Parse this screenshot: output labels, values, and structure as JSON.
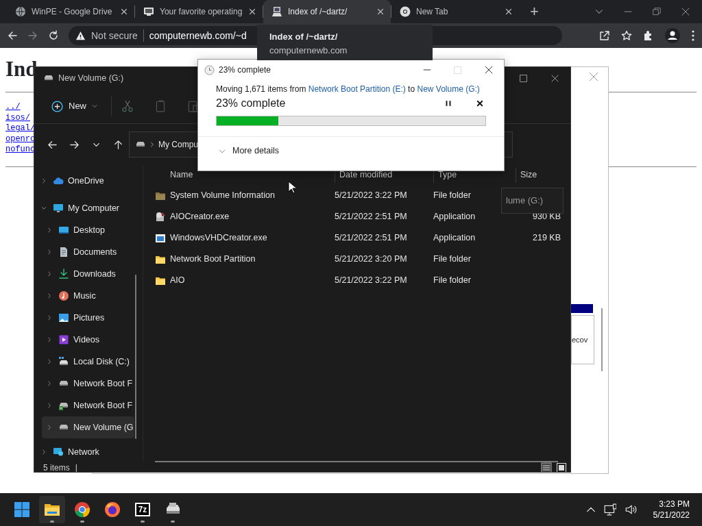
{
  "browser": {
    "tabs": [
      {
        "title": "WinPE - Google Drive",
        "kind": "globe",
        "selected": false
      },
      {
        "title": "Your favorite operating",
        "kind": "screen",
        "selected": false
      },
      {
        "title": "Index of /~dartz/",
        "kind": "computer",
        "selected": true
      },
      {
        "title": "New Tab",
        "kind": "chrome",
        "selected": false
      }
    ],
    "new_tab": "+",
    "omnibox": {
      "security": "Not secure",
      "url": "computernewb.com/~d"
    },
    "tooltip": {
      "title": "Index of /~dartz/",
      "url": "computernewb.com"
    }
  },
  "web_page": {
    "heading": "Ind",
    "links": [
      "../",
      "isos/",
      "legal/",
      "openro",
      "nofunc"
    ]
  },
  "background_window": {
    "text": "ecov"
  },
  "explorer": {
    "title": "New Volume (G:)",
    "new_button": "New",
    "address": "My Compu",
    "search": "lume (G:)",
    "nav": [
      {
        "label": "OneDrive",
        "kind": "cloud",
        "expanded": false,
        "selected": false
      },
      {
        "label": "My Computer",
        "kind": "computer",
        "expanded": true,
        "selected": false,
        "children": [
          {
            "label": "Desktop",
            "kind": "desktop",
            "expanded": false,
            "selected": false
          },
          {
            "label": "Documents",
            "kind": "documents",
            "expanded": false,
            "selected": false
          },
          {
            "label": "Downloads",
            "kind": "downloads",
            "expanded": false,
            "selected": false
          },
          {
            "label": "Music",
            "kind": "music",
            "expanded": false,
            "selected": false
          },
          {
            "label": "Pictures",
            "kind": "pictures",
            "expanded": false,
            "selected": false
          },
          {
            "label": "Videos",
            "kind": "videos",
            "expanded": false,
            "selected": false
          },
          {
            "label": "Local Disk (C:)",
            "kind": "system-drive",
            "expanded": false,
            "selected": false
          },
          {
            "label": "Network Boot F",
            "kind": "drive",
            "expanded": false,
            "selected": false
          },
          {
            "label": "Network Boot F",
            "kind": "boot-drive",
            "expanded": false,
            "selected": false
          },
          {
            "label": "New Volume (G",
            "kind": "drive",
            "expanded": false,
            "selected": true
          }
        ]
      },
      {
        "label": "Network",
        "kind": "network",
        "expanded": false,
        "selected": false
      }
    ],
    "columns": [
      "Name",
      "Date modified",
      "Type",
      "Size"
    ],
    "files": [
      {
        "name": "System Volume Information",
        "date": "5/21/2022 3:22 PM",
        "type": "File folder",
        "kind": "hidden-folder"
      },
      {
        "name": "AIOCreator.exe",
        "date": "5/21/2022 2:51 PM",
        "type": "Application",
        "size": "930 KB",
        "kind": "setup-app"
      },
      {
        "name": "WindowsVHDCreator.exe",
        "date": "5/21/2022 2:51 PM",
        "type": "Application",
        "size": "219 KB",
        "kind": "window-app"
      },
      {
        "name": "Network Boot Partition",
        "date": "5/21/2022 3:20 PM",
        "type": "File folder",
        "kind": "folder"
      },
      {
        "name": "AIO",
        "date": "5/21/2022 3:22 PM",
        "type": "File folder",
        "kind": "folder"
      }
    ],
    "status": "5 items",
    "status_divider": "|"
  },
  "dialog": {
    "title": "23% complete",
    "message": [
      {
        "text": "Moving 1,671 items from ",
        "link": false
      },
      {
        "text": "Network Boot Partition (E:)",
        "link": true
      },
      {
        "text": " to ",
        "link": false
      },
      {
        "text": "New Volume (G:)",
        "link": true
      }
    ],
    "progress_text": "23% complete",
    "level": 0.23,
    "details": "More details"
  },
  "taskbar": {
    "apps": [
      {
        "kind": "start",
        "running": false,
        "active": false
      },
      {
        "kind": "explorer",
        "running": true,
        "active": true
      },
      {
        "kind": "chrome",
        "running": true,
        "active": false
      },
      {
        "kind": "firefox",
        "running": false,
        "active": false
      },
      {
        "kind": "archiver",
        "label": "7z",
        "running": true,
        "active": false
      },
      {
        "kind": "installer",
        "running": true,
        "active": false
      }
    ],
    "time": "3:23 PM",
    "date": "5/21/2022"
  }
}
